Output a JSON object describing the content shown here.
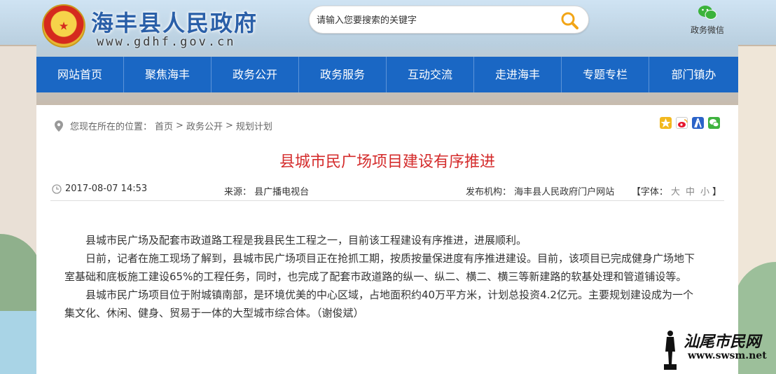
{
  "site": {
    "title": "海丰县人民政府",
    "url": "www.gdhf.gov.cn"
  },
  "search": {
    "placeholder": "请输入您要搜索的关键字"
  },
  "wechat": {
    "label": "政务微信"
  },
  "nav": {
    "items": [
      {
        "label": "网站首页"
      },
      {
        "label": "聚焦海丰"
      },
      {
        "label": "政务公开"
      },
      {
        "label": "政务服务"
      },
      {
        "label": "互动交流"
      },
      {
        "label": "走进海丰"
      },
      {
        "label": "专题专栏"
      },
      {
        "label": "部门镇办"
      }
    ]
  },
  "breadcrumb": {
    "prefix": "您现在所在的位置：",
    "items": [
      "首页",
      ">",
      "政务公开",
      ">",
      "规划计划"
    ]
  },
  "article": {
    "title": "县城市民广场项目建设有序推进",
    "date": "2017-08-07 14:53",
    "source": "来源： 县广播电视台",
    "publisher": "发布机构： 海丰县人民政府门户网站",
    "font_label": "【字体：",
    "font_large": "大",
    "font_medium": "中",
    "font_small": "小",
    "font_close": "】",
    "paragraphs": [
      "县城市民广场及配套市政道路工程是我县民生工程之一，目前该工程建设有序推进，进展顺利。",
      "日前，记者在施工现场了解到，县城市民广场项目正在抢抓工期，按质按量保进度有序推进建设。目前，该项目已完成健身广场地下室基础和底板施工建设65%的工程任务，同时，也完成了配套市政道路的纵一、纵二、横二、横三等新建路的软基处理和管道铺设等。",
      "县城市民广场项目位于附城镇南部，是环境优美的中心区域，占地面积约40万平方米，计划总投资4.2亿元。主要规划建设成为一个集文化、休闲、健身、贸易于一体的大型城市综合体。（谢俊斌）"
    ]
  },
  "watermark": {
    "brand": "汕尾市民网",
    "url": "www.swsm.net"
  },
  "colors": {
    "nav_bg": "#1a67c4",
    "title_red": "#d42b2b",
    "site_blue": "#2a5fa8"
  }
}
